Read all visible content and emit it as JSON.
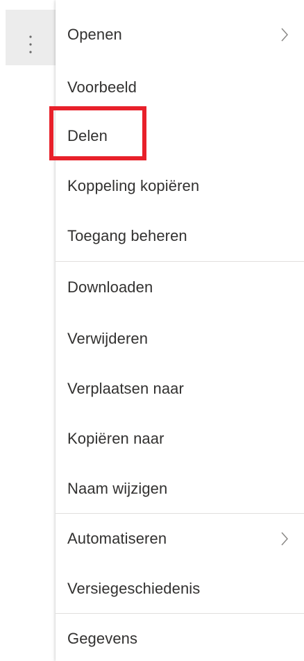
{
  "toolbar": {
    "more_icon": "vertical-ellipsis-icon"
  },
  "menu": {
    "items": [
      {
        "label": "Openen",
        "has_submenu": true
      },
      {
        "label": "Voorbeeld",
        "has_submenu": false
      },
      {
        "label": "Delen",
        "has_submenu": false,
        "highlighted": true
      },
      {
        "label": "Koppeling kopiëren",
        "has_submenu": false
      },
      {
        "label": "Toegang beheren",
        "has_submenu": false
      },
      {
        "label": "Downloaden",
        "has_submenu": false
      },
      {
        "label": "Verwijderen",
        "has_submenu": false
      },
      {
        "label": "Verplaatsen naar",
        "has_submenu": false
      },
      {
        "label": "Kopiëren naar",
        "has_submenu": false
      },
      {
        "label": "Naam wijzigen",
        "has_submenu": false
      },
      {
        "label": "Automatiseren",
        "has_submenu": true
      },
      {
        "label": "Versiegeschiedenis",
        "has_submenu": false
      },
      {
        "label": "Gegevens",
        "has_submenu": false
      }
    ],
    "submenu_icon": "chevron-right-icon"
  },
  "colors": {
    "highlight": "#e8202a",
    "text": "#323130",
    "divider": "#e1dfdd",
    "button_bg": "#ececec"
  }
}
